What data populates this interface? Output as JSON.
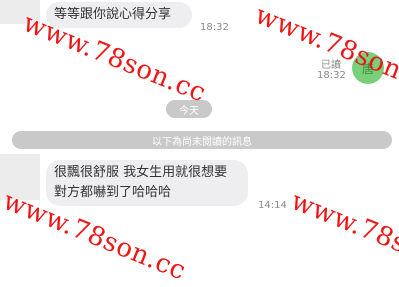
{
  "messages": [
    {
      "text": "等等跟你說心得分享",
      "time": "18:32"
    },
    {
      "sticker_glyph": "唐",
      "read_label": "已讀",
      "time": "18:32"
    },
    {
      "text_line1": "很飄很舒服 我女生用就很想要",
      "text_line2": "對方都嚇到了哈哈哈",
      "time": "14:14"
    }
  ],
  "date_divider": "今天",
  "unread_divider": "以下為尚未閱讀的訊息",
  "watermark": "www.78son.cc",
  "colors": {
    "watermark": "#ee1515",
    "bubble": "#eeeef0",
    "divider": "#c9c9c9"
  }
}
